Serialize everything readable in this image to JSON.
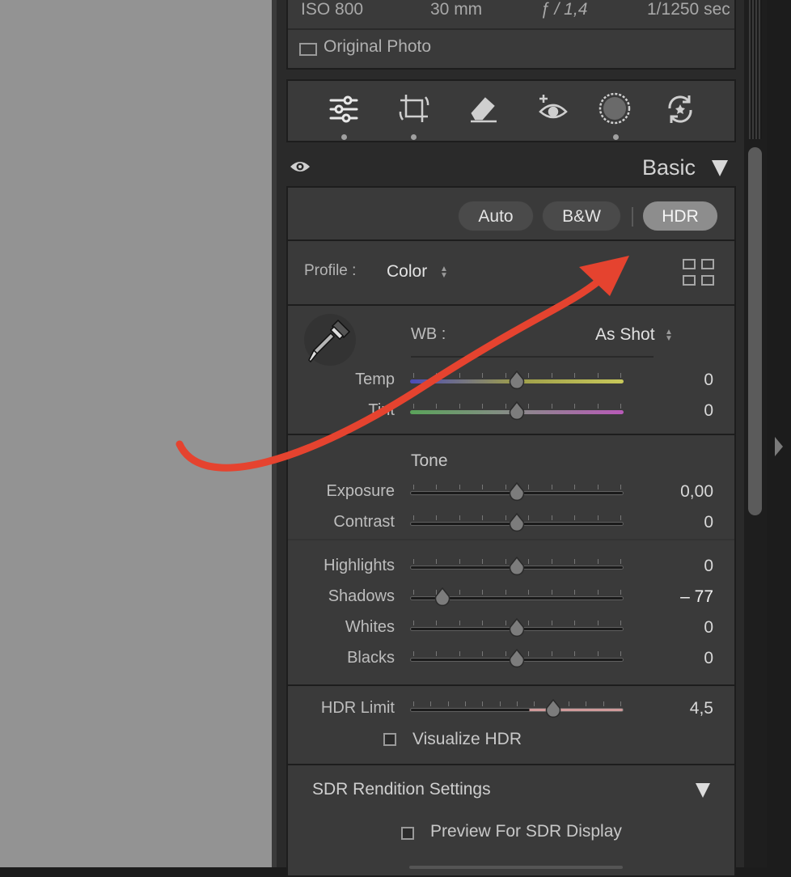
{
  "exif": {
    "iso": "ISO 800",
    "focal": "30 mm",
    "aperture": "ƒ / 1,4",
    "shutter": "1/1250 sec"
  },
  "original_photo_label": "Original Photo",
  "tools": [
    {
      "name": "edit-sliders-icon",
      "dot": true
    },
    {
      "name": "crop-icon",
      "dot": true
    },
    {
      "name": "eraser-icon",
      "dot": false
    },
    {
      "name": "red-eye-icon",
      "dot": false
    },
    {
      "name": "masking-icon",
      "dot": true
    },
    {
      "name": "presets-icon",
      "dot": false
    }
  ],
  "panel_title": "Basic",
  "treatment_buttons": {
    "auto": "Auto",
    "bw": "B&W",
    "hdr": "HDR",
    "active": "HDR"
  },
  "profile": {
    "label": "Profile :",
    "value": "Color"
  },
  "wb": {
    "label": "WB :",
    "value": "As Shot"
  },
  "sliders": {
    "temp": {
      "label": "Temp",
      "value": "0",
      "position": 0.5
    },
    "tint": {
      "label": "Tint",
      "value": "0",
      "position": 0.5
    },
    "exposure": {
      "label": "Exposure",
      "value": "0,00",
      "position": 0.5
    },
    "contrast": {
      "label": "Contrast",
      "value": "0",
      "position": 0.5
    },
    "highlights": {
      "label": "Highlights",
      "value": "0",
      "position": 0.5
    },
    "shadows": {
      "label": "Shadows",
      "value": "– 77",
      "position": 0.15
    },
    "whites": {
      "label": "Whites",
      "value": "0",
      "position": 0.5
    },
    "blacks": {
      "label": "Blacks",
      "value": "0",
      "position": 0.5
    },
    "hdr_limit": {
      "label": "HDR Limit",
      "value": "4,5",
      "position": 0.67
    }
  },
  "tone_heading": "Tone",
  "visualize_hdr": {
    "label": "Visualize HDR",
    "checked": false
  },
  "sdr_section": {
    "title": "SDR Rendition Settings",
    "preview_label": "Preview For SDR Display",
    "checked": false
  },
  "colors": {
    "annotation_arrow": "#e5432f",
    "panel_bg": "#3a3a3a",
    "canvas_bg": "#939393"
  }
}
